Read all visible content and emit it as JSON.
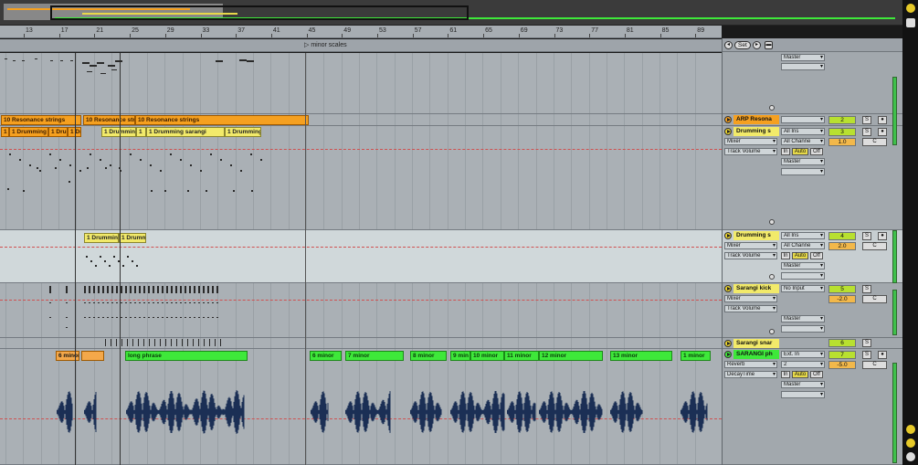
{
  "ruler": {
    "ticks": [
      "13",
      "17",
      "21",
      "25",
      "29",
      "33",
      "37",
      "41",
      "45",
      "49",
      "53",
      "57",
      "61",
      "65",
      "69",
      "73",
      "77",
      "81",
      "85",
      "89"
    ]
  },
  "locator": {
    "marker": "minor scales"
  },
  "arrangement": {
    "row1_clips": [
      {
        "label": "10 Resonance strings",
        "color": "orange"
      },
      {
        "label": "10 Resonance strings",
        "color": "orange"
      },
      {
        "label": "10 Resonance strings",
        "color": "orange"
      }
    ],
    "row2_clips": [
      {
        "label": "1",
        "color": "orange"
      },
      {
        "label": "1 Drumming",
        "color": "orange"
      },
      {
        "label": "1 Dru",
        "color": "orange"
      },
      {
        "label": "1 Dr",
        "color": "orange"
      },
      {
        "label": "1 Drummin",
        "color": "yellow"
      },
      {
        "label": "1",
        "color": "yellow"
      },
      {
        "label": "1 Drumming sarangi",
        "color": "yellow"
      },
      {
        "label": "1 Drumming",
        "color": "yellow"
      }
    ],
    "row3_clips": [
      {
        "label": "1 Drumming",
        "color": "yellow"
      },
      {
        "label": "1 Drumm",
        "color": "yellow"
      }
    ],
    "row4_clips": [
      {
        "label": "6 minor",
        "color": "lorange"
      },
      {
        "label": "",
        "color": "lorange"
      },
      {
        "label": "long phrase",
        "color": "green"
      },
      {
        "label": "6 minor",
        "color": "green"
      },
      {
        "label": "7 minor",
        "color": "green"
      },
      {
        "label": "8 minor",
        "color": "green"
      },
      {
        "label": "9 min",
        "color": "green"
      },
      {
        "label": "10 minor",
        "color": "green"
      },
      {
        "label": "11 minor",
        "color": "green"
      },
      {
        "label": "12 minor",
        "color": "green"
      },
      {
        "label": "13 minor",
        "color": "green"
      },
      {
        "label": "1 minor",
        "color": "green"
      }
    ]
  },
  "mixer": {
    "set_label": "Set",
    "tracks": [
      {
        "name": "",
        "routing": "Master",
        "name_color": "#aeb4b8"
      },
      {
        "name": "ARP Resona",
        "name_color": "#f5a020",
        "num": "2",
        "s": "S"
      },
      {
        "name": "Drumming s",
        "name_color": "#f2ea6a",
        "input": "All Ins",
        "channel": "All Channe",
        "dev": "Mixer",
        "param": "Track Volume",
        "num": "3",
        "vol": "1.0",
        "s": "S",
        "c": "C",
        "in": "In",
        "auto": "Auto",
        "off": "Off",
        "routing": "Master"
      },
      {
        "name": "Drumming s",
        "name_color": "#f2ea6a",
        "input": "All Ins",
        "channel": "All Channe",
        "dev": "Mixer",
        "param": "Track Volume",
        "num": "4",
        "vol": "2.0",
        "s": "S",
        "c": "C",
        "in": "In",
        "auto": "Auto",
        "off": "Off",
        "routing": "Master"
      },
      {
        "name": "Sarangi kick",
        "name_color": "#f2ea6a",
        "input": "No Input",
        "dev": "Mixer",
        "param": "Track Volume",
        "num": "5",
        "vol": "-2.0",
        "s": "S",
        "c": "C",
        "routing": "Master"
      },
      {
        "name": "Sarangi snar",
        "name_color": "#f2ea6a",
        "num": "6",
        "s": "S"
      },
      {
        "name": "SARANGI ph",
        "name_color": "#3ee83a",
        "input": "Ext. In",
        "channel": "2",
        "dev": "Reverb",
        "param": "DecayTime",
        "num": "7",
        "vol": "-5.0",
        "s": "S",
        "c": "C",
        "in": "In",
        "auto": "Auto",
        "off": "Off",
        "routing": "Master"
      }
    ]
  }
}
